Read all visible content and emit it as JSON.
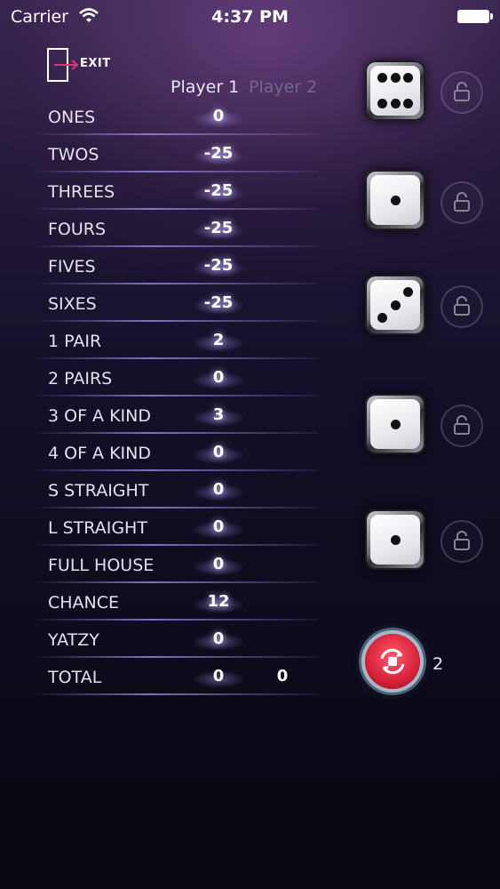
{
  "status_bar": {
    "carrier": "Carrier",
    "time": "4:37 PM"
  },
  "exit": {
    "label": "EXIT"
  },
  "players": {
    "player1": "Player 1",
    "player2": "Player 2"
  },
  "scores": [
    {
      "label": "ONES",
      "p1": "0",
      "p2": ""
    },
    {
      "label": "TWOS",
      "p1": "-25",
      "p2": ""
    },
    {
      "label": "THREES",
      "p1": "-25",
      "p2": ""
    },
    {
      "label": "FOURS",
      "p1": "-25",
      "p2": ""
    },
    {
      "label": "FIVES",
      "p1": "-25",
      "p2": ""
    },
    {
      "label": "SIXES",
      "p1": "-25",
      "p2": ""
    },
    {
      "label": "1 PAIR",
      "p1": "2",
      "p2": ""
    },
    {
      "label": "2 PAIRS",
      "p1": "0",
      "p2": ""
    },
    {
      "label": "3 OF A KIND",
      "p1": "3",
      "p2": ""
    },
    {
      "label": "4 OF A KIND",
      "p1": "0",
      "p2": ""
    },
    {
      "label": "S STRAIGHT",
      "p1": "0",
      "p2": ""
    },
    {
      "label": "L STRAIGHT",
      "p1": "0",
      "p2": ""
    },
    {
      "label": "FULL HOUSE",
      "p1": "0",
      "p2": ""
    },
    {
      "label": "CHANCE",
      "p1": "12",
      "p2": ""
    },
    {
      "label": "YATZY",
      "p1": "0",
      "p2": ""
    },
    {
      "label": "TOTAL",
      "p1": "0",
      "p2": "0"
    }
  ],
  "dice": [
    {
      "value": 6,
      "locked": false
    },
    {
      "value": 1,
      "locked": false
    },
    {
      "value": 3,
      "locked": false
    },
    {
      "value": 1,
      "locked": false
    },
    {
      "value": 1,
      "locked": false
    }
  ],
  "roll": {
    "rolls_left": "2"
  },
  "colors": {
    "accent_red": "#d8213a",
    "exit_arrow": "#e0307a"
  }
}
